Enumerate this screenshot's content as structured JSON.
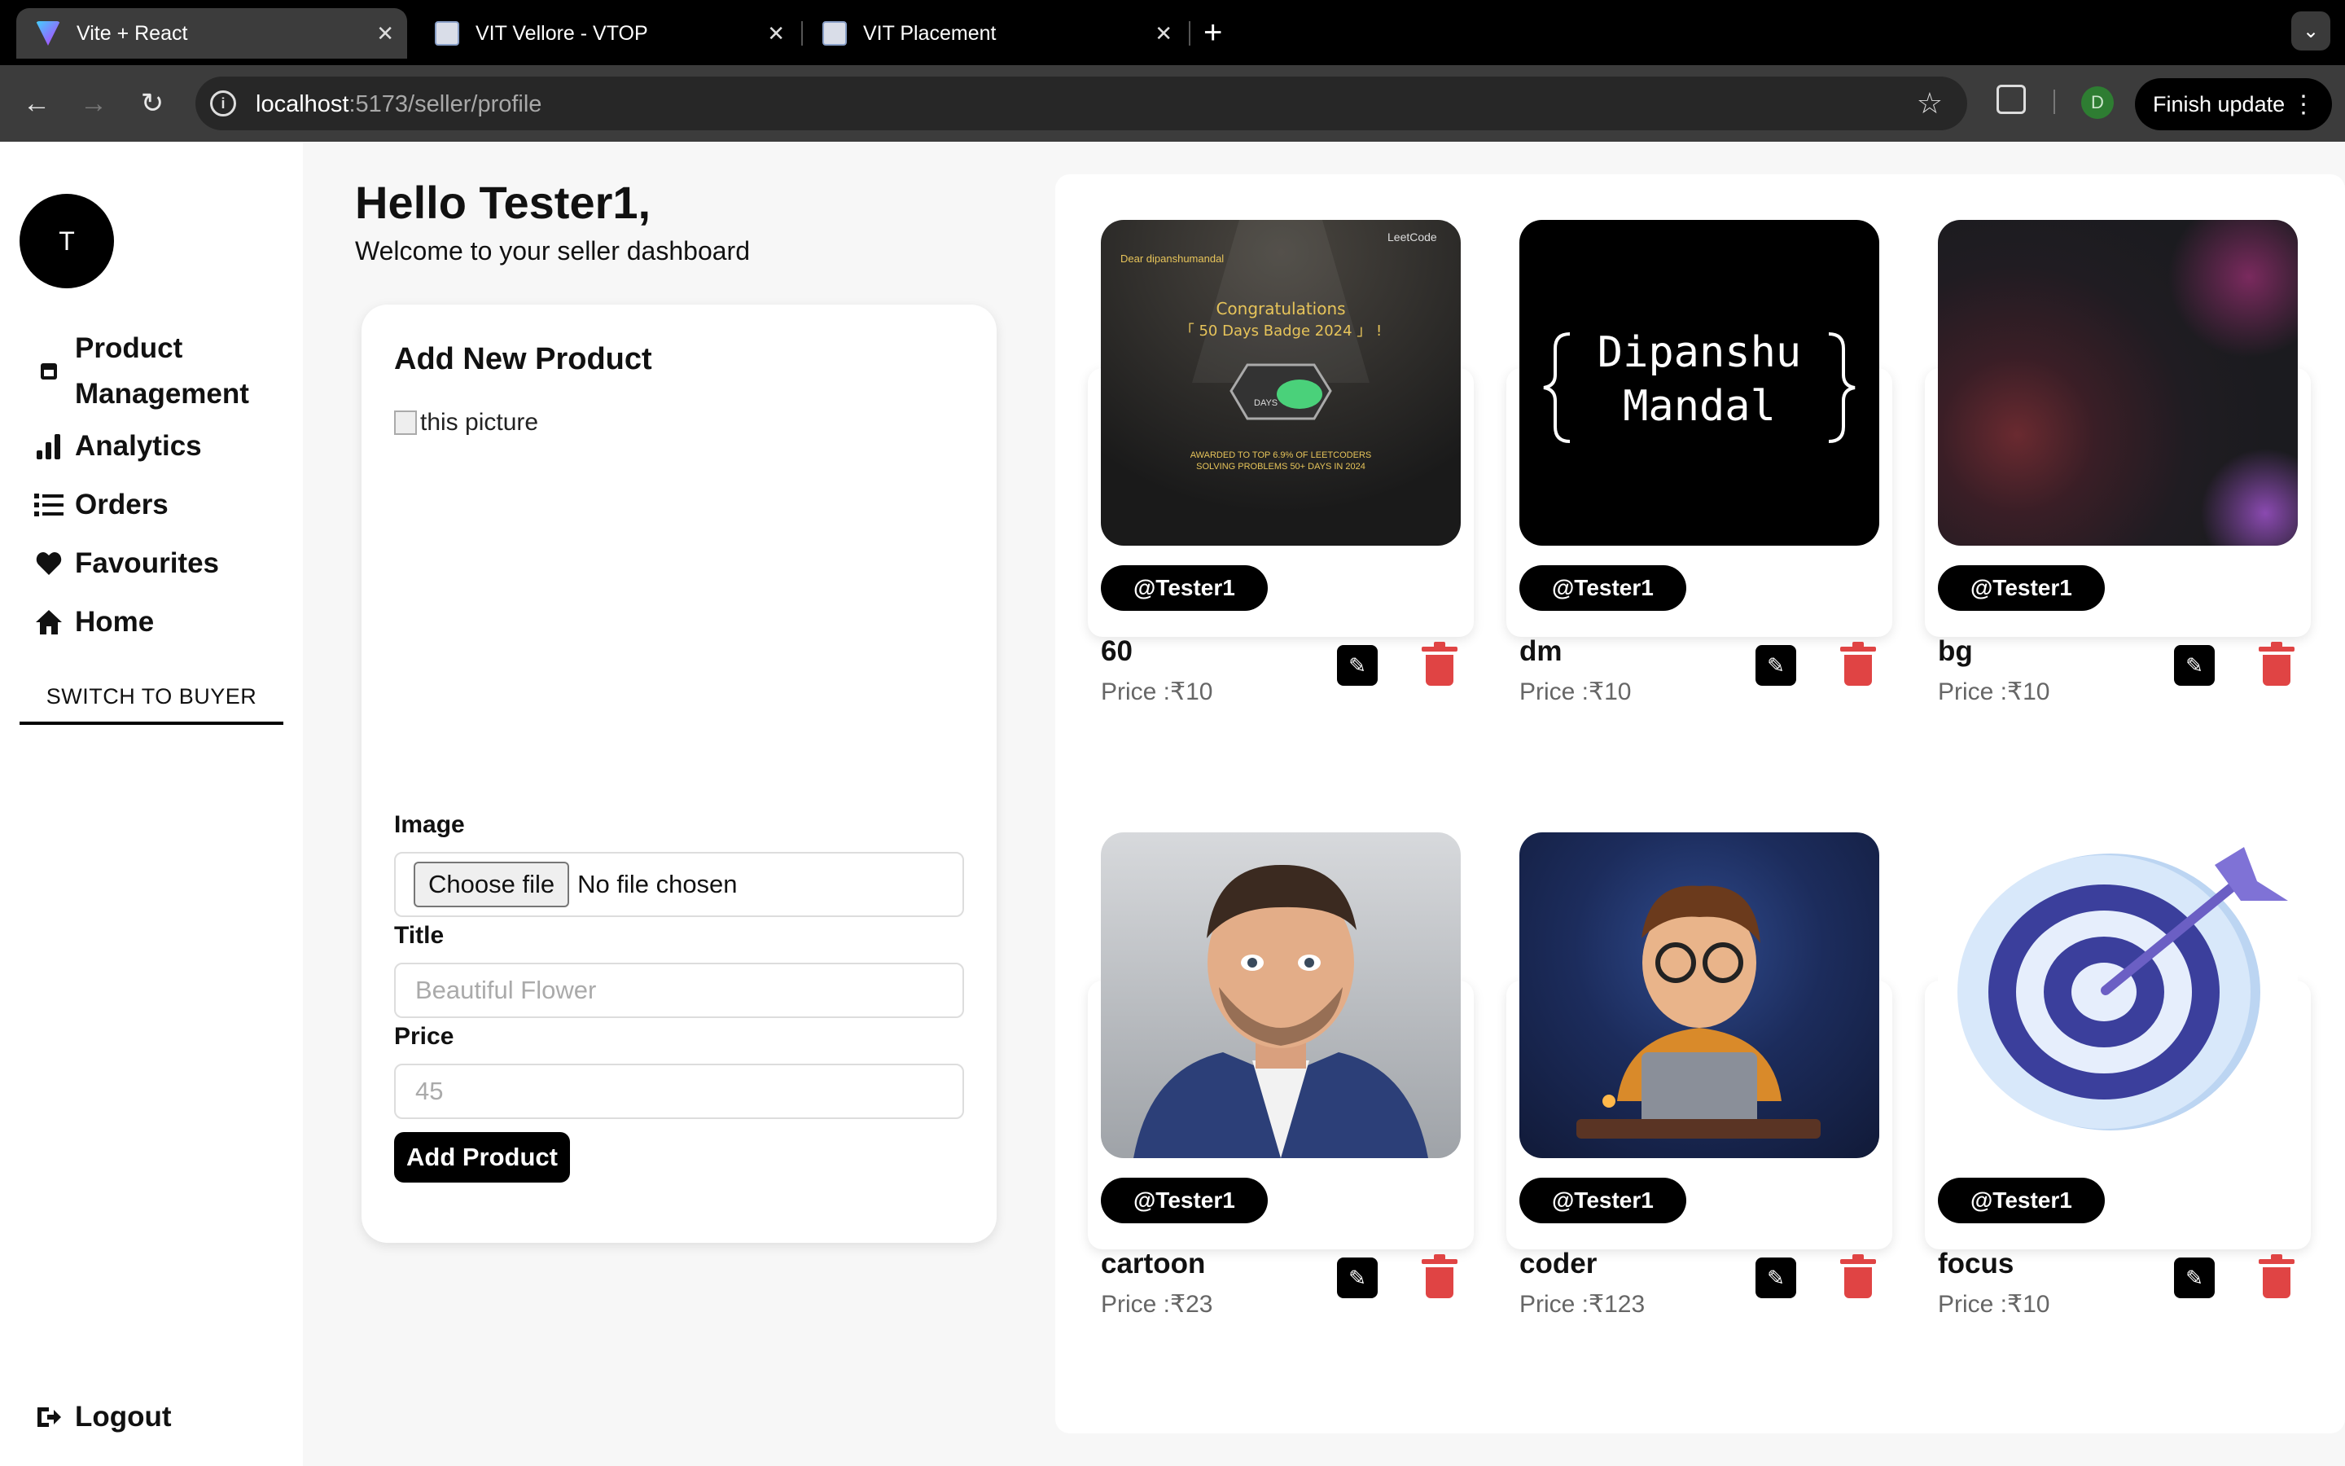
{
  "browser": {
    "tabs": [
      {
        "title": "Vite + React",
        "active": true,
        "favicon": "vite-icon"
      },
      {
        "title": "VIT Vellore - VTOP",
        "active": false,
        "favicon": "vit-icon"
      },
      {
        "title": "VIT Placement",
        "active": false,
        "favicon": "vit-icon"
      }
    ],
    "new_tab": "+",
    "url_host": "localhost",
    "url_path": ":5173/seller/profile",
    "profile_initial": "D",
    "update_label": "Finish update"
  },
  "sidebar": {
    "avatar_initial": "T",
    "items": [
      {
        "label_line1": "Product",
        "label_line2": "Management",
        "icon": "product-management-icon"
      },
      {
        "label": "Analytics",
        "icon": "analytics-icon"
      },
      {
        "label": "Orders",
        "icon": "orders-icon"
      },
      {
        "label": "Favourites",
        "icon": "heart-icon"
      },
      {
        "label": "Home",
        "icon": "home-icon"
      }
    ],
    "switch_label": "SWITCH TO BUYER",
    "logout_label": "Logout"
  },
  "header": {
    "greeting": "Hello Tester1,",
    "subtitle": "Welcome to your seller dashboard"
  },
  "add_product": {
    "title": "Add New Product",
    "preview_alt": "this picture",
    "image_label": "Image",
    "choose_file": "Choose file",
    "no_file": "No file chosen",
    "title_label": "Title",
    "title_placeholder": "Beautiful Flower",
    "price_label": "Price",
    "price_placeholder": "45",
    "submit_label": "Add Product"
  },
  "products": [
    {
      "name": "60",
      "price": "Price :₹10",
      "owner": "@Tester1",
      "image": "leetcode-badge-image",
      "img_text": {
        "dear": "Dear dipanshumandal",
        "brand": "LeetCode",
        "congrats": "Congratulations",
        "badge": "「 50 Days Badge 2024 」 !",
        "days": "DAYS",
        "awarded": "AWARDED TO TOP 6.9% OF LEETCODERS",
        "solving": "SOLVING PROBLEMS 50+ DAYS IN 2024"
      }
    },
    {
      "name": "dm",
      "price": "Price :₹10",
      "owner": "@Tester1",
      "image": "name-logo-image",
      "img_text": {
        "line1": "Dipanshu",
        "line2": "Mandal"
      }
    },
    {
      "name": "bg",
      "price": "Price :₹10",
      "owner": "@Tester1",
      "image": "gradient-background-image"
    },
    {
      "name": "cartoon",
      "price": "Price :₹23",
      "owner": "@Tester1",
      "image": "cartoon-man-image"
    },
    {
      "name": "coder",
      "price": "Price :₹123",
      "owner": "@Tester1",
      "image": "coder-character-image"
    },
    {
      "name": "focus",
      "price": "Price :₹10",
      "owner": "@Tester1",
      "image": "target-dart-image"
    }
  ],
  "colors": {
    "accent": "#000000",
    "delete": "#e04444",
    "page_bg": "#f7f7f7"
  }
}
